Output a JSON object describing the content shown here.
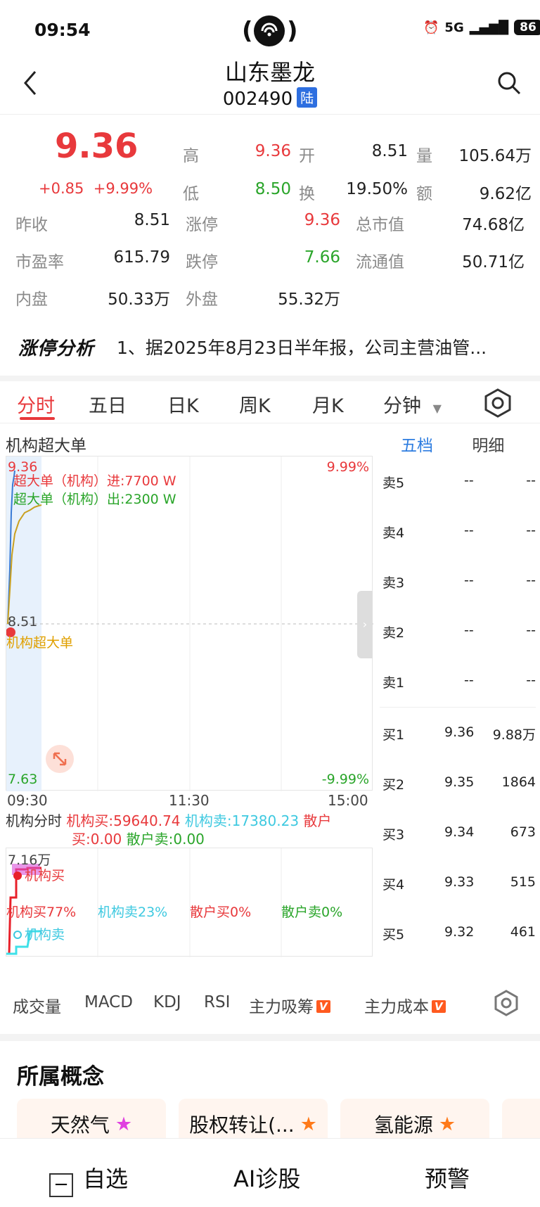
{
  "status_bar": {
    "time": "09:54",
    "network": "5G",
    "battery": "86"
  },
  "header": {
    "title": "山东墨龙",
    "code": "002490",
    "market_badge": "陆"
  },
  "quote": {
    "price": "9.36",
    "change": "+0.85",
    "change_pct": "+9.99%",
    "rows": [
      [
        {
          "label": "高",
          "value": "9.36",
          "color": "red"
        },
        {
          "label": "开",
          "value": "8.51",
          "color": "dark"
        },
        {
          "label": "量",
          "value": "105.64万",
          "color": "dark"
        }
      ],
      [
        {
          "label": "低",
          "value": "8.50",
          "color": "green"
        },
        {
          "label": "换",
          "value": "19.50%",
          "color": "dark"
        },
        {
          "label": "额",
          "value": "9.62亿",
          "color": "dark"
        }
      ]
    ],
    "grid": [
      [
        {
          "label": "昨收",
          "value": "8.51",
          "color": "dark"
        },
        {
          "label": "涨停",
          "value": "9.36",
          "color": "red"
        },
        {
          "label": "总市值",
          "value": "74.68亿",
          "color": "dark"
        }
      ],
      [
        {
          "label": "市盈率",
          "value": "615.79",
          "color": "dark"
        },
        {
          "label": "跌停",
          "value": "7.66",
          "color": "green"
        },
        {
          "label": "流通值",
          "value": "50.71亿",
          "color": "dark"
        }
      ],
      [
        {
          "label": "内盘",
          "value": "50.33万",
          "color": "dark"
        },
        {
          "label": "外盘",
          "value": "55.32万",
          "color": "dark"
        }
      ]
    ]
  },
  "limit_analysis": {
    "logo": "涨停分析",
    "text": "1、据2025年8月23日半年报，公司主营油管..."
  },
  "tabs": [
    {
      "label": "分时",
      "active": true
    },
    {
      "label": "五日",
      "active": false
    },
    {
      "label": "日K",
      "active": false
    },
    {
      "label": "周K",
      "active": false
    },
    {
      "label": "月K",
      "active": false
    },
    {
      "label": "分钟",
      "active": false
    }
  ],
  "chart": {
    "title": "机构超大单",
    "top_price": "9.36",
    "top_pct": "9.99%",
    "mid_price": "8.51",
    "bottom_price": "7.63",
    "bottom_pct": "-9.99%",
    "in_label": "超大单（机构）进:7700 W",
    "out_label": "超大单（机构）出:2300 W",
    "overlay_label": "机构超大单",
    "x_ticks": [
      "09:30",
      "11:30",
      "15:00"
    ]
  },
  "order_book": {
    "tabs": [
      "五档",
      "明细"
    ],
    "asks": [
      {
        "label": "卖5",
        "price": "--",
        "vol": "--"
      },
      {
        "label": "卖4",
        "price": "--",
        "vol": "--"
      },
      {
        "label": "卖3",
        "price": "--",
        "vol": "--"
      },
      {
        "label": "卖2",
        "price": "--",
        "vol": "--"
      },
      {
        "label": "卖1",
        "price": "--",
        "vol": "--"
      }
    ],
    "bids": [
      {
        "label": "买1",
        "price": "9.36",
        "vol": "9.88万"
      },
      {
        "label": "买2",
        "price": "9.35",
        "vol": "1864"
      },
      {
        "label": "买3",
        "price": "9.34",
        "vol": "673"
      },
      {
        "label": "买4",
        "price": "9.33",
        "vol": "515"
      },
      {
        "label": "买5",
        "price": "9.32",
        "vol": "461"
      }
    ]
  },
  "sub_chart": {
    "title": "机构分时",
    "inst_buy": "机构买:59640.74",
    "inst_sell": "机构卖:17380.23",
    "retail_buy_a": "散户",
    "retail_buy_b": "买:0.00",
    "retail_sell": "散户卖:0.00",
    "y_top": "7.16万",
    "legend_buy": "机构买",
    "legend_sell": "机构卖",
    "pct_inst_buy": "机构买77%",
    "pct_inst_sell": "机构卖23%",
    "pct_retail_buy": "散户买0%",
    "pct_retail_sell": "散户卖0%"
  },
  "indicators": [
    {
      "label": "成交量",
      "tag": ""
    },
    {
      "label": "MACD",
      "tag": ""
    },
    {
      "label": "KDJ",
      "tag": ""
    },
    {
      "label": "RSI",
      "tag": ""
    },
    {
      "label": "主力吸筹",
      "tag": "V"
    },
    {
      "label": "主力成本",
      "tag": "V"
    }
  ],
  "concepts": {
    "title": "所属概念",
    "items": [
      {
        "label": "天然气",
        "star_color": "#e040e0"
      },
      {
        "label": "股权转让(...",
        "star_color": "#ff7a1a"
      },
      {
        "label": "氢能源",
        "star_color": "#ff7a1a"
      }
    ]
  },
  "bottom_bar": {
    "watch": "自选",
    "ai": "AI诊股",
    "alert": "预警"
  }
}
